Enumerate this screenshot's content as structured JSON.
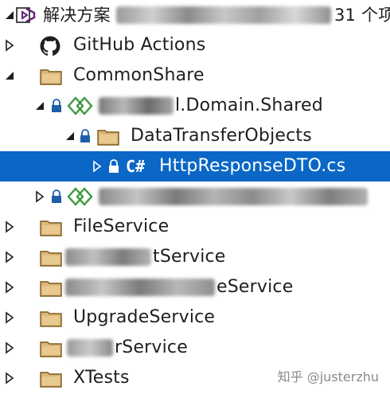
{
  "solution": {
    "label": "解决方案",
    "count_text": "31 个项"
  },
  "tree": {
    "github_actions": "GitHub Actions",
    "common_share": "CommonShare",
    "domain_shared_suffix": "l.Domain.Shared",
    "data_transfer_objects": "DataTransferObjects",
    "http_response_dto": "HttpResponseDTO.cs",
    "csharp_badge": "C#",
    "file_service": "FileService",
    "payment_service_suffix": "tService",
    "message_service_suffix": "eService",
    "upgrade_service": "UpgradeService",
    "order_service_suffix": "rService",
    "xtests": "XTests"
  },
  "watermark": "知乎 @justerzhu",
  "colors": {
    "selection": "#0a67c6",
    "folder_fill": "#dcb67a",
    "folder_stroke": "#7a5a1a",
    "vs_purple": "#68217a",
    "project_green": "#3c9a3c"
  }
}
